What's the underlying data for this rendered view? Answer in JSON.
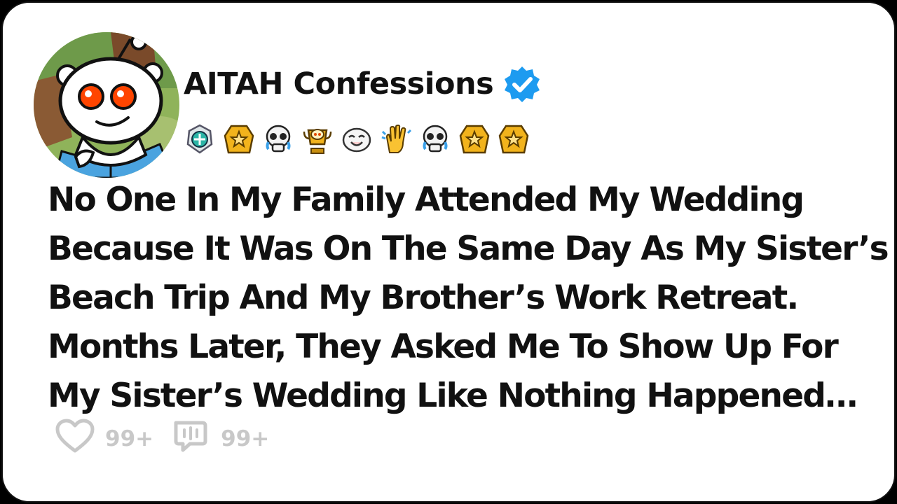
{
  "post": {
    "author": "AITAH Confessions",
    "verified_icon": "verified-badge-icon",
    "awards": [
      "silver-gem-award-icon",
      "gold-star-award-icon",
      "crying-skull-award-icon",
      "trophy-snoo-award-icon",
      "laughing-face-award-icon",
      "high-five-award-icon",
      "crying-skull-award-icon",
      "gold-star-award-icon",
      "gold-star-award-icon"
    ],
    "title_lines": [
      "No One In My Family Attended My Wedding",
      "Because It Was On The Same Day As My Sister’s",
      "Beach Trip And My Brother’s Work Retreat.",
      "Months Later, They Asked Me To Show Up For",
      "My Sister’s Wedding Like Nothing Happened…"
    ],
    "likes": "99+",
    "comments": "99+"
  },
  "colors": {
    "verified": "#1d9bf0",
    "gold": "#f2b31c",
    "snoo_eye": "#ff4500",
    "muted": "#c8c8c8",
    "text": "#111111"
  }
}
